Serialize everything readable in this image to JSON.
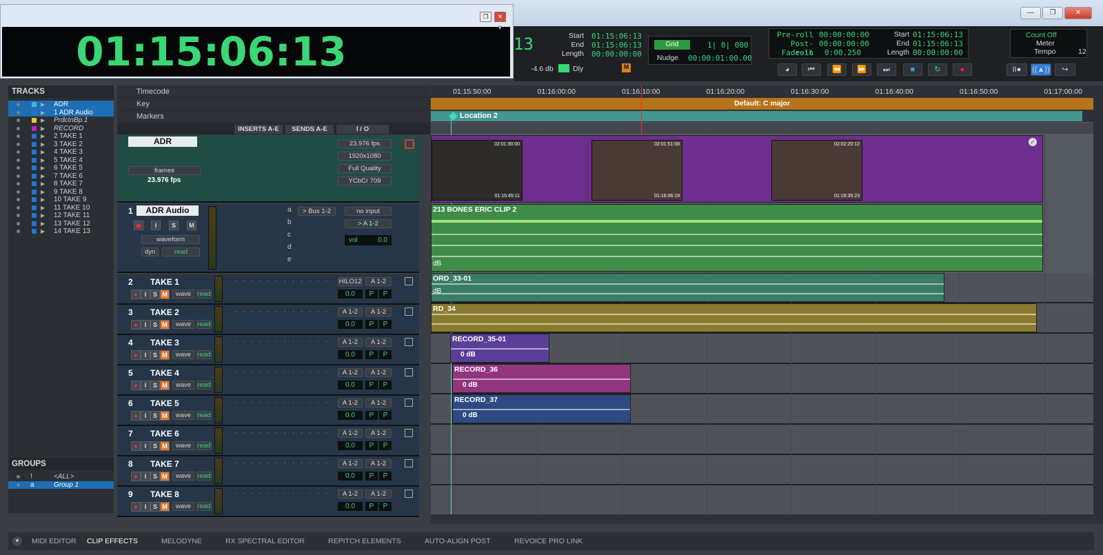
{
  "counter": {
    "time": "01:15:06:13"
  },
  "transport": {
    "partial_counter": "13",
    "start_label": "Start",
    "end_label": "End",
    "length_label": "Length",
    "start": "01:15:06:13",
    "end": "01:15:06:13",
    "length": "00:00:00:00",
    "level": "-4.6 db",
    "dly": "Dly",
    "grid_label": "Grid",
    "grid_value": "1| 0| 000",
    "nudge_label": "Nudge",
    "nudge_value": "00:00:01:00.00",
    "preroll_label": "Pre-roll",
    "postroll_label": "Post-roll",
    "fadein_label": "Fade-in",
    "preroll": "00:00:00:00",
    "postroll": "00:00:00:00",
    "fadein": "0:00.250",
    "sel_start": "01:15:06:13",
    "sel_end": "01:15:06:13",
    "sel_length": "00:00:00:00",
    "count_off": "Count Off",
    "meter": "Meter",
    "tempo": "Tempo",
    "tempo_value": "12"
  },
  "sidebar": {
    "tracks_title": "TRACKS",
    "tracks": [
      {
        "name": "ADR",
        "color": "#4ab3d4",
        "sel": true,
        "italic": false
      },
      {
        "name": "1 ADR Audio",
        "color": "#1e76d6",
        "sel": true,
        "italic": false
      },
      {
        "name": "PrdctnBp.1",
        "color": "#e0d02a",
        "sel": false,
        "italic": true
      },
      {
        "name": "RECORD",
        "color": "#c21ecf",
        "sel": false,
        "italic": true
      },
      {
        "name": "2 TAKE 1",
        "color": "#1e76d6",
        "sel": false,
        "italic": false
      },
      {
        "name": "3 TAKE 2",
        "color": "#1e76d6",
        "sel": false,
        "italic": false
      },
      {
        "name": "4 TAKE 3",
        "color": "#1e76d6",
        "sel": false,
        "italic": false
      },
      {
        "name": "5 TAKE 4",
        "color": "#1e76d6",
        "sel": false,
        "italic": false
      },
      {
        "name": "6 TAKE 5",
        "color": "#1e76d6",
        "sel": false,
        "italic": false
      },
      {
        "name": "7 TAKE 6",
        "color": "#1e76d6",
        "sel": false,
        "italic": false
      },
      {
        "name": "8 TAKE 7",
        "color": "#1e76d6",
        "sel": false,
        "italic": false
      },
      {
        "name": "9 TAKE 8",
        "color": "#1e76d6",
        "sel": false,
        "italic": false
      },
      {
        "name": "10 TAKE 9",
        "color": "#1e76d6",
        "sel": false,
        "italic": false
      },
      {
        "name": "11 TAKE 10",
        "color": "#1e76d6",
        "sel": false,
        "italic": false
      },
      {
        "name": "12 TAKE 11",
        "color": "#1e76d6",
        "sel": false,
        "italic": false
      },
      {
        "name": "13 TAKE 12",
        "color": "#1e76d6",
        "sel": false,
        "italic": false
      },
      {
        "name": "14 TAKE 13",
        "color": "#1e76d6",
        "sel": false,
        "italic": false
      }
    ],
    "groups_title": "GROUPS",
    "groups": [
      {
        "id": "!",
        "name": "<ALL>",
        "sel": false
      },
      {
        "id": "a",
        "name": "Group 1",
        "sel": true
      }
    ]
  },
  "header": {
    "timecode": "Timecode",
    "key": "Key",
    "markers": "Markers",
    "inserts": "INSERTS A-E",
    "sends": "SENDS A-E",
    "io": "I / O"
  },
  "video_track": {
    "name": "ADR",
    "fps": "23.976 fps",
    "fps_display": "23.976 fps",
    "resolution": "1920x1080",
    "quality": "Full Quality",
    "colorspace": "YCbCr 709",
    "frames": "frames"
  },
  "adr_audio": {
    "number": "1",
    "name": "ADR Audio",
    "view": "waveform",
    "dyn": "dyn",
    "auto": "read",
    "send_a": "> Bus 1-2",
    "send_letters": [
      "a",
      "b",
      "c",
      "d",
      "e"
    ],
    "input": "no input",
    "output": "> A 1-2",
    "vol_label": "vol",
    "vol": "0.0"
  },
  "takes": [
    {
      "num": "2",
      "name": "TAKE 1",
      "in": "HILO12",
      "out": "A 1-2",
      "vol": "0.0"
    },
    {
      "num": "3",
      "name": "TAKE 2",
      "in": "A 1-2",
      "out": "A 1-2",
      "vol": "0.0"
    },
    {
      "num": "4",
      "name": "TAKE 3",
      "in": "A 1-2",
      "out": "A 1-2",
      "vol": "0.0"
    },
    {
      "num": "5",
      "name": "TAKE 4",
      "in": "A 1-2",
      "out": "A 1-2",
      "vol": "0.0"
    },
    {
      "num": "6",
      "name": "TAKE 5",
      "in": "A 1-2",
      "out": "A 1-2",
      "vol": "0.0"
    },
    {
      "num": "7",
      "name": "TAKE 6",
      "in": "A 1-2",
      "out": "A 1-2",
      "vol": "0.0"
    },
    {
      "num": "8",
      "name": "TAKE 7",
      "in": "A 1-2",
      "out": "A 1-2",
      "vol": "0.0"
    },
    {
      "num": "9",
      "name": "TAKE 8",
      "in": "A 1-2",
      "out": "A 1-2",
      "vol": "0.0"
    }
  ],
  "take_controls": {
    "view": "wave",
    "auto": "read",
    "pan": "P"
  },
  "ruler_ticks": [
    "01:15:50:00",
    "01:16:00:00",
    "01:16:10:00",
    "01:16:20:00",
    "01:16:30:00",
    "01:16:40:00",
    "01:16:50:00",
    "01:17:00:00"
  ],
  "key_text": "Default: C major",
  "marker_text": "Location 2",
  "video_clip": {
    "name": "213 BONES ERIC CLIP 2",
    "tc": [
      "02:01:30:00",
      "02:01:51:08",
      "02:02:20:12"
    ],
    "tc_bottom": [
      "01:15:45:11",
      "01:16:06:19",
      "01:16:35:23"
    ]
  },
  "clips": {
    "adr": "213 BONES ERIC CLIP 2",
    "t1": "ORD_33-01",
    "t2": "RD_34",
    "t3": "RECORD_35-01",
    "t4": "RECORD_36",
    "t5": "RECORD_37",
    "db": "dB",
    "zero_db": "0 dB"
  },
  "bottom_tabs": [
    "MIDI EDITOR",
    "CLIP EFFECTS",
    "MELODYNE",
    "RX SPECTRAL EDITOR",
    "REPITCH ELEMENTS",
    "AUTO-ALIGN POST",
    "REVOICE PRO LINK"
  ]
}
